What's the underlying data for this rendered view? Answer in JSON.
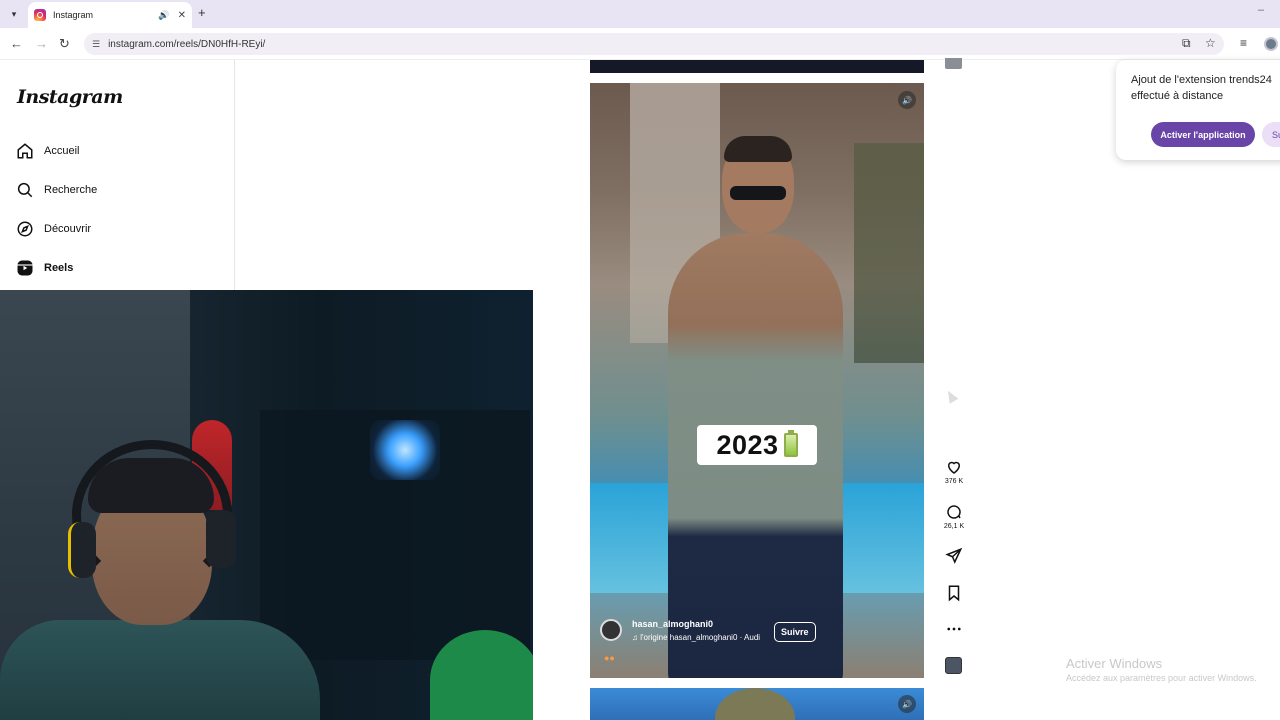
{
  "browser": {
    "tab_title": "Instagram",
    "url": "instagram.com/reels/DN0HfH-REyi/",
    "new_tab_label": "+",
    "close_tab_label": "✕"
  },
  "sidebar": {
    "logo": "Instagram",
    "items": [
      {
        "label": "Accueil",
        "icon": "home-icon"
      },
      {
        "label": "Recherche",
        "icon": "search-icon"
      },
      {
        "label": "Découvrir",
        "icon": "compass-icon"
      },
      {
        "label": "Reels",
        "icon": "reels-icon"
      }
    ]
  },
  "reel": {
    "year_text": "2023",
    "username": "hasan_almoghani0",
    "audio_text": "l'origine  hasan_almoghani0 · Audi",
    "follow_label": "Suivre"
  },
  "actions": {
    "likes": "376 K",
    "comments": "26,1 K"
  },
  "extension_popup": {
    "message": "Ajout de l'extension trends24 effectué à distance",
    "primary_button": "Activer l'application",
    "secondary_button": "Su"
  },
  "windows_watermark": {
    "title": "Activer Windows",
    "subtitle": "Accédez aux paramètres pour activer Windows."
  }
}
